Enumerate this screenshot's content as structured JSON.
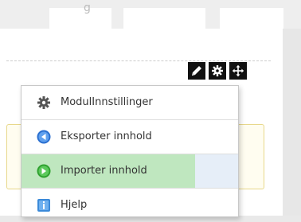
{
  "top_tabs": {
    "partial_label": "g"
  },
  "toolbar": {
    "icons": [
      "pencil-icon",
      "gear-icon",
      "move-arrows-icon"
    ],
    "color": "#111111"
  },
  "menu": {
    "items": [
      {
        "label": "ModulInnstillinger",
        "icon": "gear-icon"
      },
      {
        "label": "Eksporter innhold",
        "icon": "export-icon"
      },
      {
        "label": "Importer innhold",
        "icon": "import-icon",
        "highlighted": true
      },
      {
        "label": "Hjelp",
        "icon": "help-icon"
      }
    ]
  },
  "colors": {
    "highlight": "#bfe7bf",
    "hover_row": "#e6eef8",
    "notice_border": "#e8d88a",
    "export_icon": "#2a6fd0",
    "import_icon": "#2fa12f",
    "help_icon": "#3b8ad9"
  }
}
